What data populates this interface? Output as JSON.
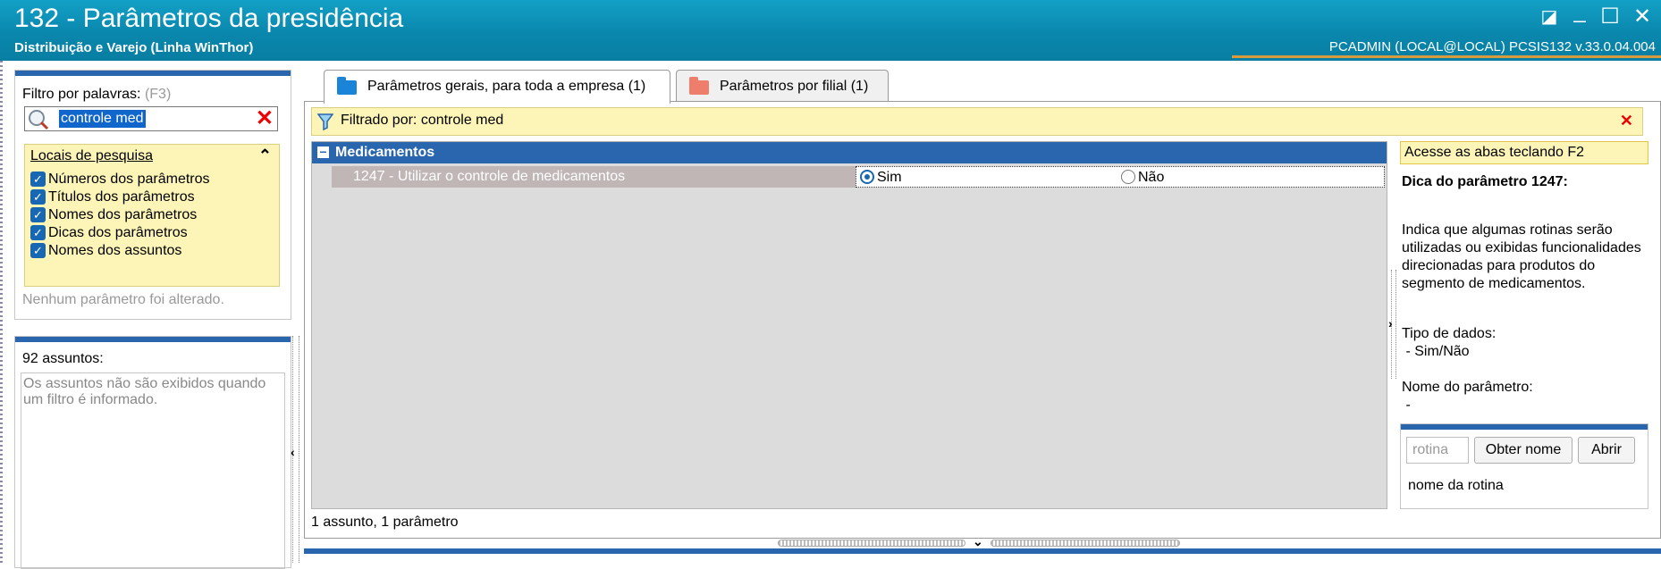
{
  "window": {
    "title": "132 - Parâmetros da presidência",
    "subtitle": "Distribuição e Varejo (Linha WinThor)",
    "user_info": "PCADMIN (LOCAL@LOCAL)   PCSIS132  v.33.0.04.004",
    "controls": {
      "restore": "◪",
      "minimize": "_",
      "maximize": "☐",
      "close": "✕"
    }
  },
  "filter_panel": {
    "label": "Filtro por palavras:",
    "shortcut": "(F3)",
    "search_value": "controle med",
    "clear_icon": "✕",
    "locais": {
      "title": "Locais de pesquisa",
      "collapse_icon": "⌃",
      "options": [
        {
          "label": "Números dos parâmetros",
          "checked": true
        },
        {
          "label": "Títulos dos parâmetros",
          "checked": true
        },
        {
          "label": "Nomes dos parâmetros",
          "checked": true
        },
        {
          "label": "Dicas dos parâmetros",
          "checked": true
        },
        {
          "label": "Nomes dos assuntos",
          "checked": true
        }
      ]
    },
    "status": "Nenhum parâmetro foi alterado."
  },
  "subjects_panel": {
    "count_label": "92 assuntos:",
    "message_line1": "Os assuntos não são exibidos quando",
    "message_line2": "um filtro é informado."
  },
  "tabs": [
    {
      "label": "Parâmetros gerais, para toda a empresa  (1)",
      "active": true,
      "folder_color": "#1a84d8"
    },
    {
      "label": "Parâmetros por filial  (1)",
      "active": false,
      "folder_color": "#ef7d6b"
    }
  ],
  "filter_banner": {
    "text": "Filtrado por: controle med",
    "close_icon": "✕"
  },
  "grid": {
    "group": {
      "toggle": "−",
      "name": "Medicamentos"
    },
    "param": {
      "title": "1247 - Utilizar o controle de medicamentos",
      "options": [
        {
          "label": "Sim",
          "selected": true
        },
        {
          "label": "Não",
          "selected": false
        }
      ]
    }
  },
  "summary": "1 assunto, 1 parâmetro",
  "right_panel": {
    "access_tip": "Acesse as abas teclando F2",
    "hint_title": "Dica do parâmetro 1247:",
    "hint_lines": [
      "Indica que algumas rotinas serão",
      "utilizadas ou exibidas funcionalidades",
      "direcionadas para produtos do",
      "segmento de medicamentos."
    ],
    "data_type_label": "Tipo de dados:",
    "data_type_value": " - Sim/Não",
    "param_name_label": "Nome do parâmetro:",
    "param_name_value": " -"
  },
  "routine": {
    "placeholder": "rotina",
    "get_name_label": "Obter nome",
    "open_label": "Abrir",
    "name_label": "nome da rotina"
  }
}
